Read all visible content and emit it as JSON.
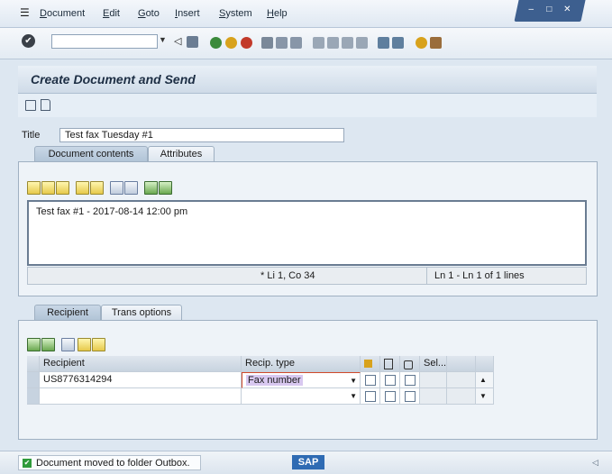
{
  "menu": {
    "items": [
      "Document",
      "Edit",
      "Goto",
      "Insert",
      "System",
      "Help"
    ]
  },
  "toolbar": {
    "command_field": ""
  },
  "page": {
    "title": "Create Document and Send"
  },
  "document": {
    "title_label": "Title",
    "title_value": "Test fax Tuesday #1",
    "tabs": [
      "Document contents",
      "Attributes"
    ],
    "editor_text": "Test fax #1 - 2017-08-14 12:00 pm",
    "cursor_position": "* Li 1, Co 34",
    "line_info": "Ln 1 - Ln 1 of 1 lines"
  },
  "recipient": {
    "tabs": [
      "Recipient",
      "Trans options"
    ],
    "columns": {
      "recipient": "Recipient",
      "recip_type": "Recip. type",
      "sel": "Sel..."
    },
    "rows": [
      {
        "recipient": "US8776314294",
        "recip_type": "Fax number"
      },
      {
        "recipient": "",
        "recip_type": ""
      }
    ]
  },
  "status": {
    "message": "Document moved to folder Outbox.",
    "logo": "SAP"
  },
  "colors": {
    "accent": "#3d5f8f",
    "highlight": "#d8c8f0",
    "ok_green": "#2f9a3a"
  }
}
